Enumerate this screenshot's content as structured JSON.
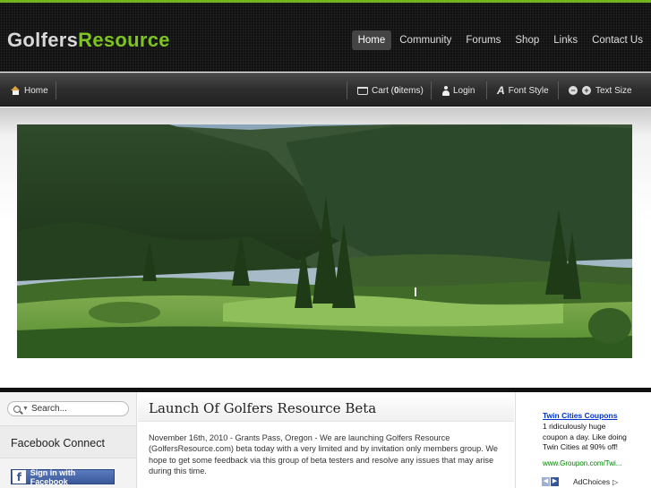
{
  "header": {
    "logo_part1": "Golfers",
    "logo_part2": "Resource",
    "nav": [
      {
        "label": "Home",
        "active": true
      },
      {
        "label": "Community"
      },
      {
        "label": "Forums"
      },
      {
        "label": "Shop"
      },
      {
        "label": "Links"
      },
      {
        "label": "Contact Us"
      }
    ]
  },
  "toolbar": {
    "home_label": "Home",
    "cart_prefix": "Cart (",
    "cart_count": "0",
    "cart_suffix": " items)",
    "login_label": "Login",
    "font_style_label": "Font Style",
    "font_icon_glyph": "A",
    "text_size_label": "Text Size",
    "decrease_glyph": "−",
    "increase_glyph": "+"
  },
  "sidebar": {
    "search_placeholder": "Search...",
    "facebook_heading": "Facebook Connect",
    "facebook_button": "Sign in with Facebook",
    "facebook_glyph": "f"
  },
  "article": {
    "title": "Launch Of Golfers Resource Beta",
    "body": "November 16th, 2010 - Grants Pass, Oregon - We are launching Golfers Resource (GolfersResource.com) beta today with a very limited and by invitation only members group.  We hope to get some feedback via this group of beta testers and resolve any issues that may arise during this time."
  },
  "ad": {
    "title": "Twin Cities Coupons",
    "text": "1 ridiculously huge coupon a day. Like doing Twin Cities at 90% off!",
    "url": "www.Groupon.com/Twi...",
    "adchoices": "AdChoices",
    "prev_glyph": "◀",
    "next_glyph": "▶"
  },
  "colors": {
    "accent_green": "#7dc41f",
    "header_bg": "#111111",
    "facebook_blue": "#3b5998",
    "ad_link": "#0033cc",
    "ad_url": "#008000"
  },
  "icons": [
    "home-icon",
    "cart-icon",
    "user-icon",
    "font-style-icon",
    "text-decrease-icon",
    "text-increase-icon",
    "search-icon",
    "facebook-icon"
  ]
}
